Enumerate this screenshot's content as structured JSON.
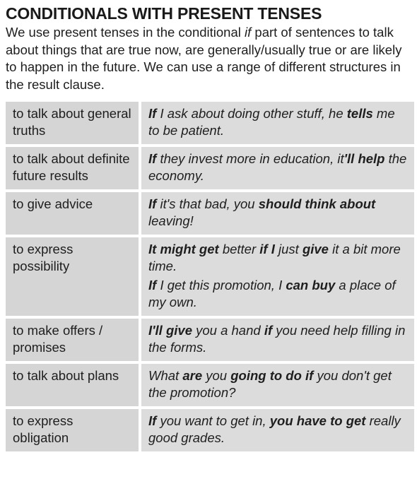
{
  "title": "CONDITIONALS WITH PRESENT TENSES",
  "intro": {
    "before": "We use present tenses in the conditional ",
    "italic_word": "if",
    "after": " part of sentences to talk about things that are true now, are generally/usually true or are likely to happen in the future. We can use a range of different structures in the result clause."
  },
  "rows": [
    {
      "use": "to talk about general truths",
      "examples": [
        [
          {
            "t": "If",
            "b": true
          },
          {
            "t": " I ask about doing other stuff, he ",
            "b": false
          },
          {
            "t": "tells",
            "b": true
          },
          {
            "t": " me to be patient.",
            "b": false
          }
        ]
      ]
    },
    {
      "use": "to talk about definite future results",
      "examples": [
        [
          {
            "t": "If",
            "b": true
          },
          {
            "t": " they invest more in education, it",
            "b": false
          },
          {
            "t": "'ll help",
            "b": true
          },
          {
            "t": " the economy.",
            "b": false
          }
        ]
      ]
    },
    {
      "use": "to give advice",
      "examples": [
        [
          {
            "t": "If",
            "b": true
          },
          {
            "t": " it's that bad, you ",
            "b": false
          },
          {
            "t": "should think about",
            "b": true
          },
          {
            "t": " leaving!",
            "b": false
          }
        ]
      ]
    },
    {
      "use": "to express possibility",
      "examples": [
        [
          {
            "t": "It might get",
            "b": true
          },
          {
            "t": " better ",
            "b": false
          },
          {
            "t": "if I",
            "b": true
          },
          {
            "t": " just ",
            "b": false
          },
          {
            "t": "give",
            "b": true
          },
          {
            "t": " it a bit more time.",
            "b": false
          }
        ],
        [
          {
            "t": "If",
            "b": true
          },
          {
            "t": " I get this promotion, I ",
            "b": false
          },
          {
            "t": "can buy",
            "b": true
          },
          {
            "t": " a place of my own.",
            "b": false
          }
        ]
      ]
    },
    {
      "use": "to make offers / promises",
      "examples": [
        [
          {
            "t": "I'll give",
            "b": true
          },
          {
            "t": " you a hand ",
            "b": false
          },
          {
            "t": "if",
            "b": true
          },
          {
            "t": " you need help filling in the forms.",
            "b": false
          }
        ]
      ]
    },
    {
      "use": "to talk about plans",
      "examples": [
        [
          {
            "t": "What ",
            "b": false
          },
          {
            "t": "are",
            "b": true
          },
          {
            "t": " you ",
            "b": false
          },
          {
            "t": "going to do if",
            "b": true
          },
          {
            "t": " you don't get the promotion?",
            "b": false
          }
        ]
      ]
    },
    {
      "use": "to express obligation",
      "examples": [
        [
          {
            "t": "If",
            "b": true
          },
          {
            "t": " you want to get in, ",
            "b": false
          },
          {
            "t": "you have to get",
            "b": true
          },
          {
            "t": " really good grades.",
            "b": false
          }
        ]
      ]
    }
  ]
}
